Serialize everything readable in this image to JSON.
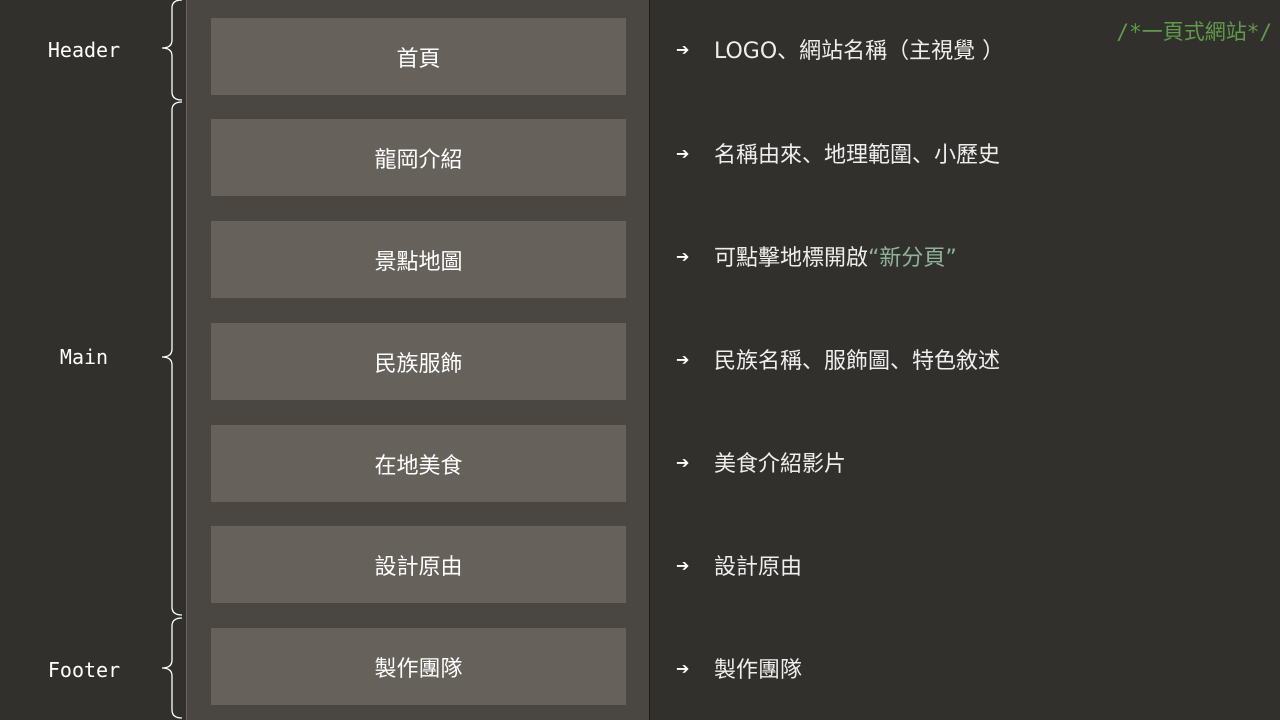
{
  "comment": "/*一頁式網站*/",
  "sections": {
    "header": "Header",
    "main": "Main",
    "footer": "Footer"
  },
  "boxes": [
    "首頁",
    "龍岡介紹",
    "景點地圖",
    "民族服飾",
    "在地美食",
    "設計原由",
    "製作團隊"
  ],
  "descriptions": [
    "LOGO、網站名稱（主視覺 ）",
    "名稱由來、地理範圍、小歷史",
    "可點擊地標開啟",
    "民族名稱、服飾圖、特色敘述",
    "美食介紹影片",
    "設計原由",
    "製作團隊"
  ],
  "map_highlight": "“新分頁”",
  "arrow_symbol": "➔",
  "colors": {
    "background": "#32302d",
    "column": "#4a4642",
    "box": "#66615b",
    "comment": "#5f9b4a",
    "highlight": "#8fb39a"
  }
}
